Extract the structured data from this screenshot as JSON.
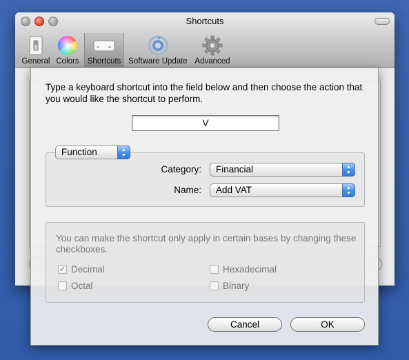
{
  "window": {
    "title": "Shortcuts"
  },
  "toolbar": {
    "items": [
      {
        "label": "General",
        "icon": "light-switch-icon"
      },
      {
        "label": "Colors",
        "icon": "color-wheel-icon"
      },
      {
        "label": "Shortcuts",
        "icon": "keyboard-icon",
        "selected": true
      },
      {
        "label": "Software Update",
        "icon": "software-update-icon"
      },
      {
        "label": "Advanced",
        "icon": "gear-icon"
      }
    ]
  },
  "sheet": {
    "instructions": "Type a keyboard shortcut into the field below and then choose the action that you would like the shortcut to perform.",
    "shortcut_value": "V",
    "action_type": "Function",
    "category_label": "Category:",
    "category_value": "Financial",
    "name_label": "Name:",
    "name_value": "Add VAT",
    "bases_note": "You can make the shortcut only apply in certain bases by changing these checkboxes.",
    "checkboxes": [
      {
        "label": "Decimal",
        "checked": true
      },
      {
        "label": "Hexadecimal",
        "checked": false
      },
      {
        "label": "Octal",
        "checked": false
      },
      {
        "label": "Binary",
        "checked": false
      }
    ],
    "cancel_label": "Cancel",
    "ok_label": "OK"
  }
}
